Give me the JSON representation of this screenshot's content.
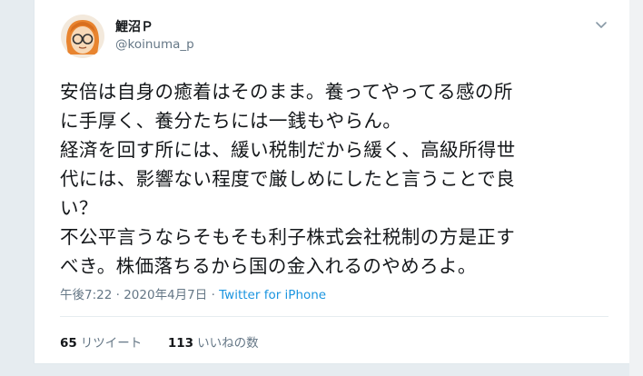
{
  "tweet": {
    "display_name": "鯉沼Ｐ",
    "handle": "@koinuma_p",
    "lines": [
      "安倍は自身の癒着はそのまま。養ってやってる感の所",
      "に手厚く、養分たちには一銭もやらん。",
      "経済を回す所には、緩い税制だから緩く、高級所得世",
      "代には、影響ない程度で厳しめにしたと言うことで良",
      "い？",
      "不公平言うならそもそも利子株式会社税制の方是正す",
      "べき。株価落ちるから国の金入れるのやめろよ。"
    ],
    "time": "午後7:22",
    "date": "2020年4月7日",
    "separator": "·",
    "source": "Twitter for iPhone",
    "retweet_count": "65",
    "retweet_label": "リツイート",
    "like_count": "113",
    "like_label": "いいねの数"
  },
  "icons": [
    "avatar-image",
    "chevron-down-icon"
  ],
  "colors": {
    "background": "#e6ecf0",
    "text": "#14171a",
    "secondary": "#657786",
    "link": "#1b95e0"
  }
}
